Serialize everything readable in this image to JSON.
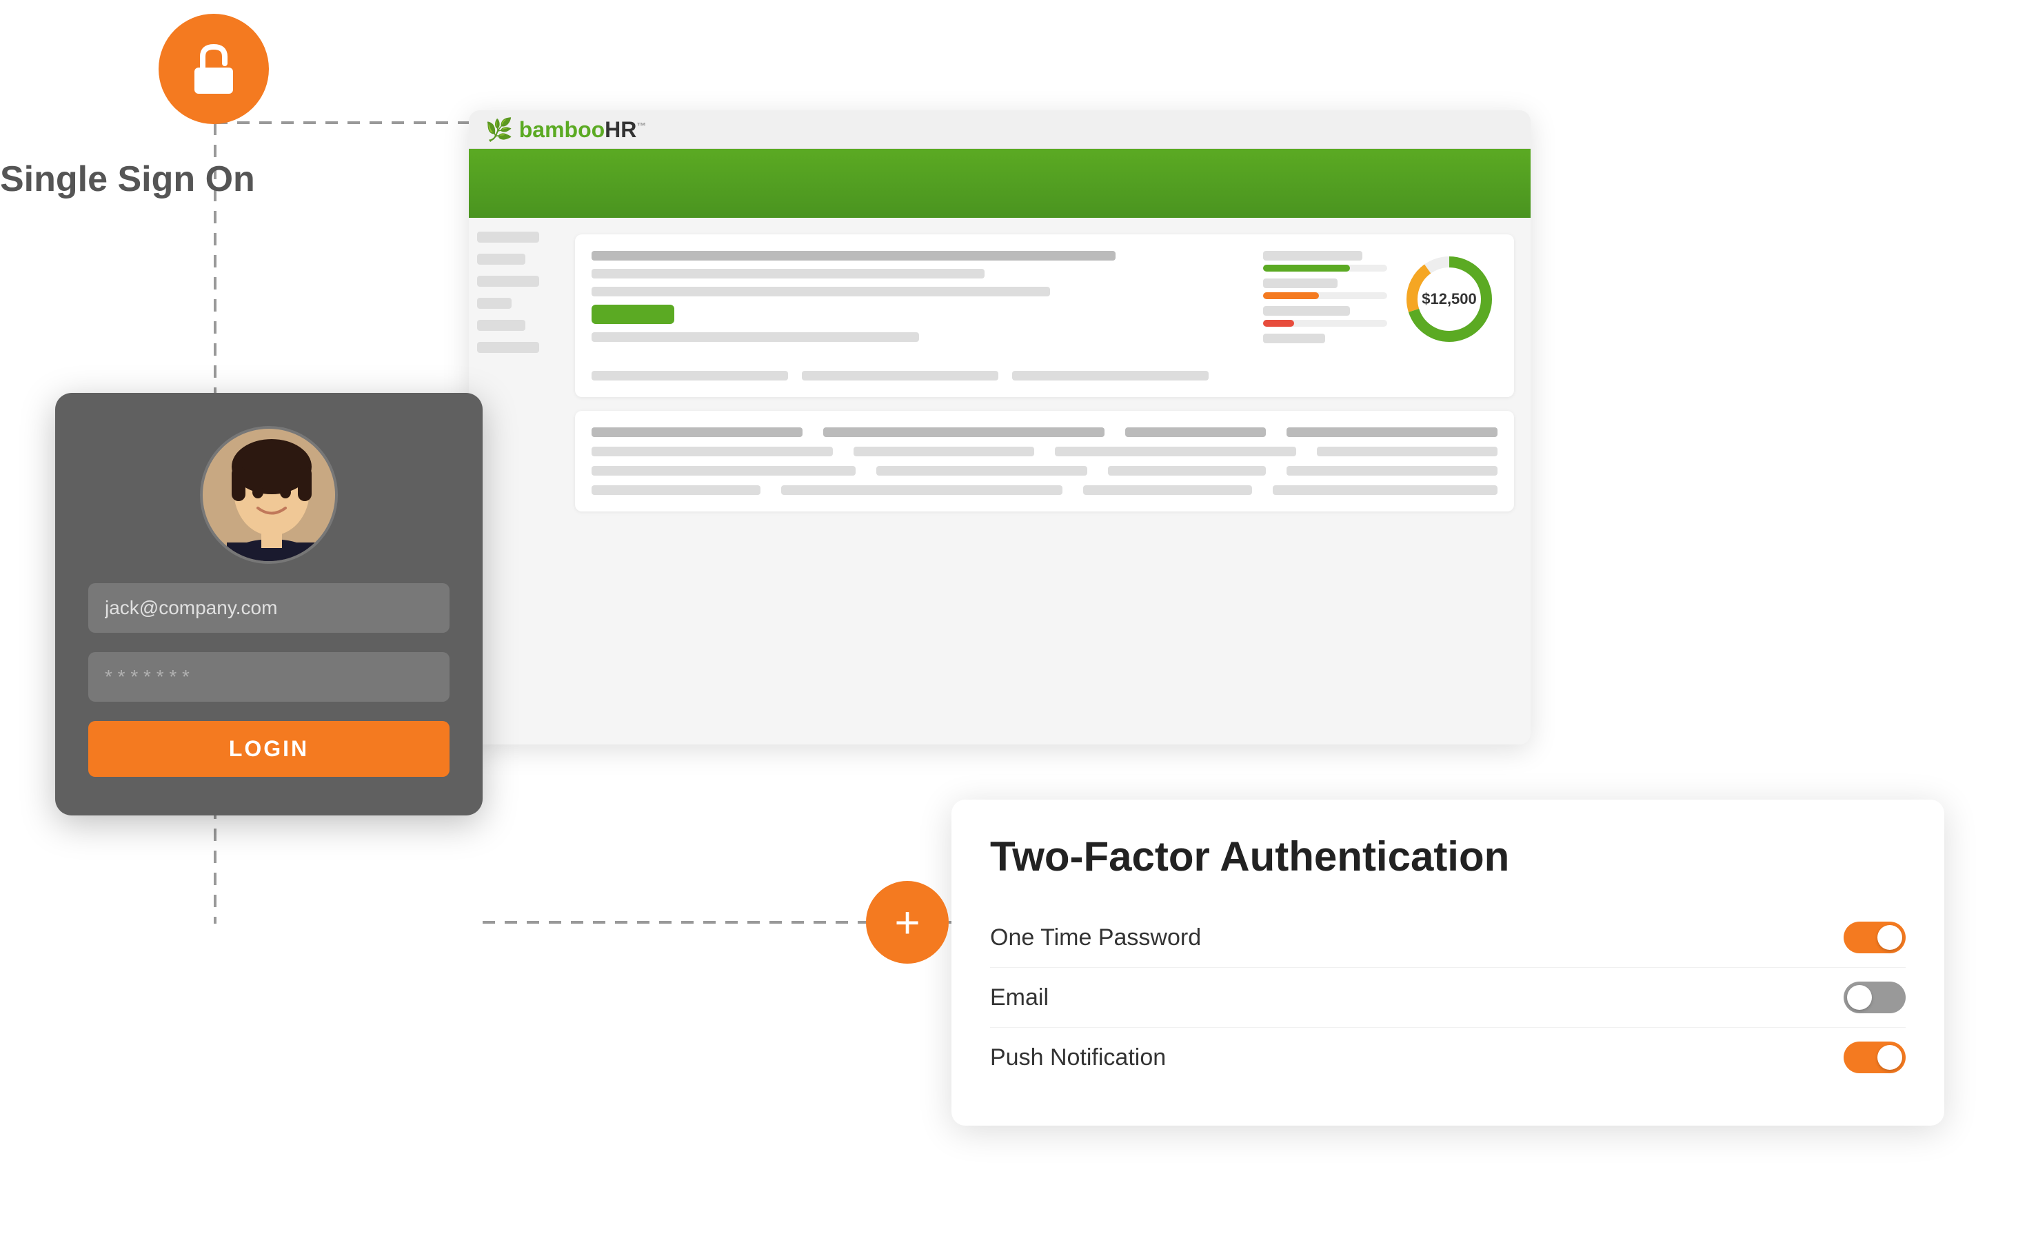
{
  "sso": {
    "label": "Single Sign On"
  },
  "bamboo": {
    "logo": "bamboo",
    "logoHR": "HR",
    "trademark": "™"
  },
  "donut": {
    "label": "$12,500",
    "green_pct": 70,
    "orange_pct": 20,
    "gray_pct": 10
  },
  "login": {
    "email_value": "jack@company.com",
    "password_placeholder": "* * * * * * *",
    "button_label": "LOGIN"
  },
  "tfa": {
    "title": "Two-Factor Authentication",
    "rows": [
      {
        "label": "One Time Password",
        "state": "on"
      },
      {
        "label": "Email",
        "state": "off"
      },
      {
        "label": "Push Notification",
        "state": "on"
      }
    ]
  },
  "plus_symbol": "+"
}
